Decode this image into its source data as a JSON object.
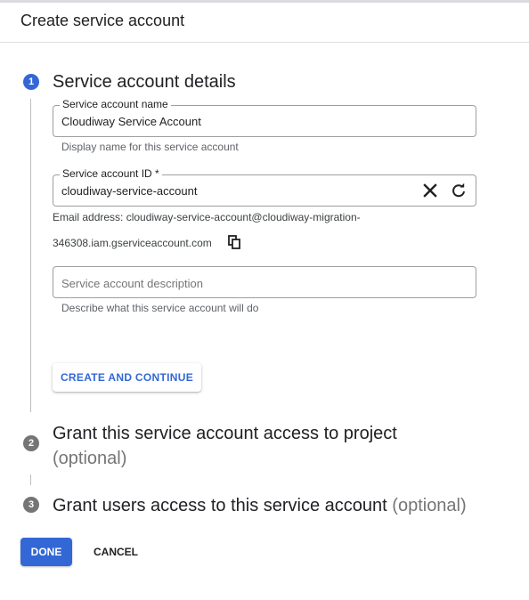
{
  "dialog": {
    "title": "Create service account"
  },
  "steps": [
    {
      "number": "1",
      "title": "Service account details",
      "optional": ""
    },
    {
      "number": "2",
      "title": "Grant this service account access to project",
      "optional": "(optional)"
    },
    {
      "number": "3",
      "title": "Grant users access to this service account",
      "optional": "(optional)"
    }
  ],
  "form": {
    "name": {
      "label": "Service account name",
      "value": "Cloudiway Service Account",
      "hint": "Display name for this service account"
    },
    "id": {
      "label": "Service account ID *",
      "value": "cloudiway-service-account",
      "email_line1": "Email address: cloudiway-service-account@cloudiway-migration-",
      "email_line2": "346308.iam.gserviceaccount.com"
    },
    "description": {
      "placeholder": "Service account description",
      "hint": "Describe what this service account will do"
    }
  },
  "buttons": {
    "create_continue": "CREATE AND CONTINUE",
    "done": "DONE",
    "cancel": "CANCEL"
  },
  "icons": {
    "clear": "close-icon",
    "refresh": "refresh-icon",
    "copy": "copy-icon"
  },
  "colors": {
    "accent": "#3367d6",
    "inactive_step": "#757575"
  }
}
